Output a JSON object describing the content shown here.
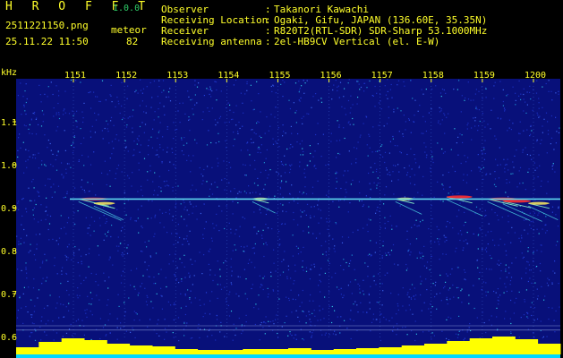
{
  "header": {
    "app_title": "H R O F F T",
    "version": "1.0.0",
    "file_name": "2511221150.png",
    "mode": "meteor",
    "timestamp": "25.11.22 11:50",
    "count": "82",
    "meta": [
      {
        "label": "Observer",
        "value": "Takanori Kawachi"
      },
      {
        "label": "Receiving Location",
        "value": "Ogaki, Gifu, JAPAN (136.60E, 35.35N)"
      },
      {
        "label": "Receiver",
        "value": "R820T2(RTL-SDR) SDR-Sharp 53.1000MHz"
      },
      {
        "label": "Receiving antenna",
        "value": "2el-HB9CV Vertical (el. E-W)"
      }
    ]
  },
  "colors": {
    "background": "#000000",
    "label_yellow": "#ffff2a",
    "label_green": "#2fd06a",
    "spectrogram_noise": "#08107a",
    "carrier": "#5fd9f0",
    "meteor_echo": "#ff3030",
    "activity_fill": "#ffff00",
    "activity_base": "#00d8ff"
  },
  "chart_data": {
    "type": "heatmap",
    "ylabel": "kHz",
    "x_ticks": [
      "1151",
      "1152",
      "1153",
      "1154",
      "1155",
      "1156",
      "1157",
      "1158",
      "1159",
      "1200"
    ],
    "x_range_minutes": [
      0,
      10
    ],
    "y_ticks": [
      "1.1",
      "1.0",
      "0.9",
      "0.8",
      "0.7",
      "0.6"
    ],
    "ylim": [
      0.55,
      1.2
    ],
    "carrier_khz": 0.92,
    "meteor_echoes": [
      {
        "minute": 0.1,
        "khz": 0.92,
        "strength": 1.0
      },
      {
        "minute": 0.4,
        "khz": 0.91,
        "strength": 0.6
      },
      {
        "minute": 3.5,
        "khz": 0.92,
        "strength": 0.4
      },
      {
        "minute": 6.3,
        "khz": 0.92,
        "strength": 0.5
      },
      {
        "minute": 7.3,
        "khz": 0.925,
        "strength": 0.8
      },
      {
        "minute": 8.1,
        "khz": 0.92,
        "strength": 1.0
      },
      {
        "minute": 8.4,
        "khz": 0.915,
        "strength": 0.9
      },
      {
        "minute": 8.9,
        "khz": 0.91,
        "strength": 0.6
      }
    ],
    "activity": [
      8,
      14,
      18,
      16,
      12,
      10,
      9,
      6,
      5,
      5,
      6,
      6,
      7,
      5,
      6,
      7,
      8,
      10,
      12,
      15,
      18,
      20,
      17,
      12
    ]
  }
}
